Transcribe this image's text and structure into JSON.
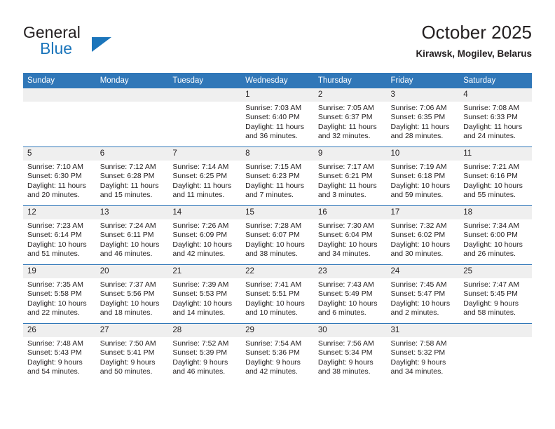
{
  "brand": {
    "name_top": "General",
    "name_bottom": "Blue",
    "accent_color": "#1b75bb"
  },
  "header": {
    "title": "October 2025",
    "subtitle": "Kirawsk, Mogilev, Belarus"
  },
  "calendar": {
    "header_bg": "#3077b8",
    "daynum_bg": "#efefef",
    "weekday_headers": [
      "Sunday",
      "Monday",
      "Tuesday",
      "Wednesday",
      "Thursday",
      "Friday",
      "Saturday"
    ],
    "weeks": [
      [
        {
          "day": "",
          "blank": true
        },
        {
          "day": "",
          "blank": true
        },
        {
          "day": "",
          "blank": true
        },
        {
          "day": "1",
          "sunrise": "Sunrise: 7:03 AM",
          "sunset": "Sunset: 6:40 PM",
          "daylight": "Daylight: 11 hours and 36 minutes."
        },
        {
          "day": "2",
          "sunrise": "Sunrise: 7:05 AM",
          "sunset": "Sunset: 6:37 PM",
          "daylight": "Daylight: 11 hours and 32 minutes."
        },
        {
          "day": "3",
          "sunrise": "Sunrise: 7:06 AM",
          "sunset": "Sunset: 6:35 PM",
          "daylight": "Daylight: 11 hours and 28 minutes."
        },
        {
          "day": "4",
          "sunrise": "Sunrise: 7:08 AM",
          "sunset": "Sunset: 6:33 PM",
          "daylight": "Daylight: 11 hours and 24 minutes."
        }
      ],
      [
        {
          "day": "5",
          "sunrise": "Sunrise: 7:10 AM",
          "sunset": "Sunset: 6:30 PM",
          "daylight": "Daylight: 11 hours and 20 minutes."
        },
        {
          "day": "6",
          "sunrise": "Sunrise: 7:12 AM",
          "sunset": "Sunset: 6:28 PM",
          "daylight": "Daylight: 11 hours and 15 minutes."
        },
        {
          "day": "7",
          "sunrise": "Sunrise: 7:14 AM",
          "sunset": "Sunset: 6:25 PM",
          "daylight": "Daylight: 11 hours and 11 minutes."
        },
        {
          "day": "8",
          "sunrise": "Sunrise: 7:15 AM",
          "sunset": "Sunset: 6:23 PM",
          "daylight": "Daylight: 11 hours and 7 minutes."
        },
        {
          "day": "9",
          "sunrise": "Sunrise: 7:17 AM",
          "sunset": "Sunset: 6:21 PM",
          "daylight": "Daylight: 11 hours and 3 minutes."
        },
        {
          "day": "10",
          "sunrise": "Sunrise: 7:19 AM",
          "sunset": "Sunset: 6:18 PM",
          "daylight": "Daylight: 10 hours and 59 minutes."
        },
        {
          "day": "11",
          "sunrise": "Sunrise: 7:21 AM",
          "sunset": "Sunset: 6:16 PM",
          "daylight": "Daylight: 10 hours and 55 minutes."
        }
      ],
      [
        {
          "day": "12",
          "sunrise": "Sunrise: 7:23 AM",
          "sunset": "Sunset: 6:14 PM",
          "daylight": "Daylight: 10 hours and 51 minutes."
        },
        {
          "day": "13",
          "sunrise": "Sunrise: 7:24 AM",
          "sunset": "Sunset: 6:11 PM",
          "daylight": "Daylight: 10 hours and 46 minutes."
        },
        {
          "day": "14",
          "sunrise": "Sunrise: 7:26 AM",
          "sunset": "Sunset: 6:09 PM",
          "daylight": "Daylight: 10 hours and 42 minutes."
        },
        {
          "day": "15",
          "sunrise": "Sunrise: 7:28 AM",
          "sunset": "Sunset: 6:07 PM",
          "daylight": "Daylight: 10 hours and 38 minutes."
        },
        {
          "day": "16",
          "sunrise": "Sunrise: 7:30 AM",
          "sunset": "Sunset: 6:04 PM",
          "daylight": "Daylight: 10 hours and 34 minutes."
        },
        {
          "day": "17",
          "sunrise": "Sunrise: 7:32 AM",
          "sunset": "Sunset: 6:02 PM",
          "daylight": "Daylight: 10 hours and 30 minutes."
        },
        {
          "day": "18",
          "sunrise": "Sunrise: 7:34 AM",
          "sunset": "Sunset: 6:00 PM",
          "daylight": "Daylight: 10 hours and 26 minutes."
        }
      ],
      [
        {
          "day": "19",
          "sunrise": "Sunrise: 7:35 AM",
          "sunset": "Sunset: 5:58 PM",
          "daylight": "Daylight: 10 hours and 22 minutes."
        },
        {
          "day": "20",
          "sunrise": "Sunrise: 7:37 AM",
          "sunset": "Sunset: 5:56 PM",
          "daylight": "Daylight: 10 hours and 18 minutes."
        },
        {
          "day": "21",
          "sunrise": "Sunrise: 7:39 AM",
          "sunset": "Sunset: 5:53 PM",
          "daylight": "Daylight: 10 hours and 14 minutes."
        },
        {
          "day": "22",
          "sunrise": "Sunrise: 7:41 AM",
          "sunset": "Sunset: 5:51 PM",
          "daylight": "Daylight: 10 hours and 10 minutes."
        },
        {
          "day": "23",
          "sunrise": "Sunrise: 7:43 AM",
          "sunset": "Sunset: 5:49 PM",
          "daylight": "Daylight: 10 hours and 6 minutes."
        },
        {
          "day": "24",
          "sunrise": "Sunrise: 7:45 AM",
          "sunset": "Sunset: 5:47 PM",
          "daylight": "Daylight: 10 hours and 2 minutes."
        },
        {
          "day": "25",
          "sunrise": "Sunrise: 7:47 AM",
          "sunset": "Sunset: 5:45 PM",
          "daylight": "Daylight: 9 hours and 58 minutes."
        }
      ],
      [
        {
          "day": "26",
          "sunrise": "Sunrise: 7:48 AM",
          "sunset": "Sunset: 5:43 PM",
          "daylight": "Daylight: 9 hours and 54 minutes."
        },
        {
          "day": "27",
          "sunrise": "Sunrise: 7:50 AM",
          "sunset": "Sunset: 5:41 PM",
          "daylight": "Daylight: 9 hours and 50 minutes."
        },
        {
          "day": "28",
          "sunrise": "Sunrise: 7:52 AM",
          "sunset": "Sunset: 5:39 PM",
          "daylight": "Daylight: 9 hours and 46 minutes."
        },
        {
          "day": "29",
          "sunrise": "Sunrise: 7:54 AM",
          "sunset": "Sunset: 5:36 PM",
          "daylight": "Daylight: 9 hours and 42 minutes."
        },
        {
          "day": "30",
          "sunrise": "Sunrise: 7:56 AM",
          "sunset": "Sunset: 5:34 PM",
          "daylight": "Daylight: 9 hours and 38 minutes."
        },
        {
          "day": "31",
          "sunrise": "Sunrise: 7:58 AM",
          "sunset": "Sunset: 5:32 PM",
          "daylight": "Daylight: 9 hours and 34 minutes."
        },
        {
          "day": "",
          "blank": true
        }
      ]
    ]
  }
}
